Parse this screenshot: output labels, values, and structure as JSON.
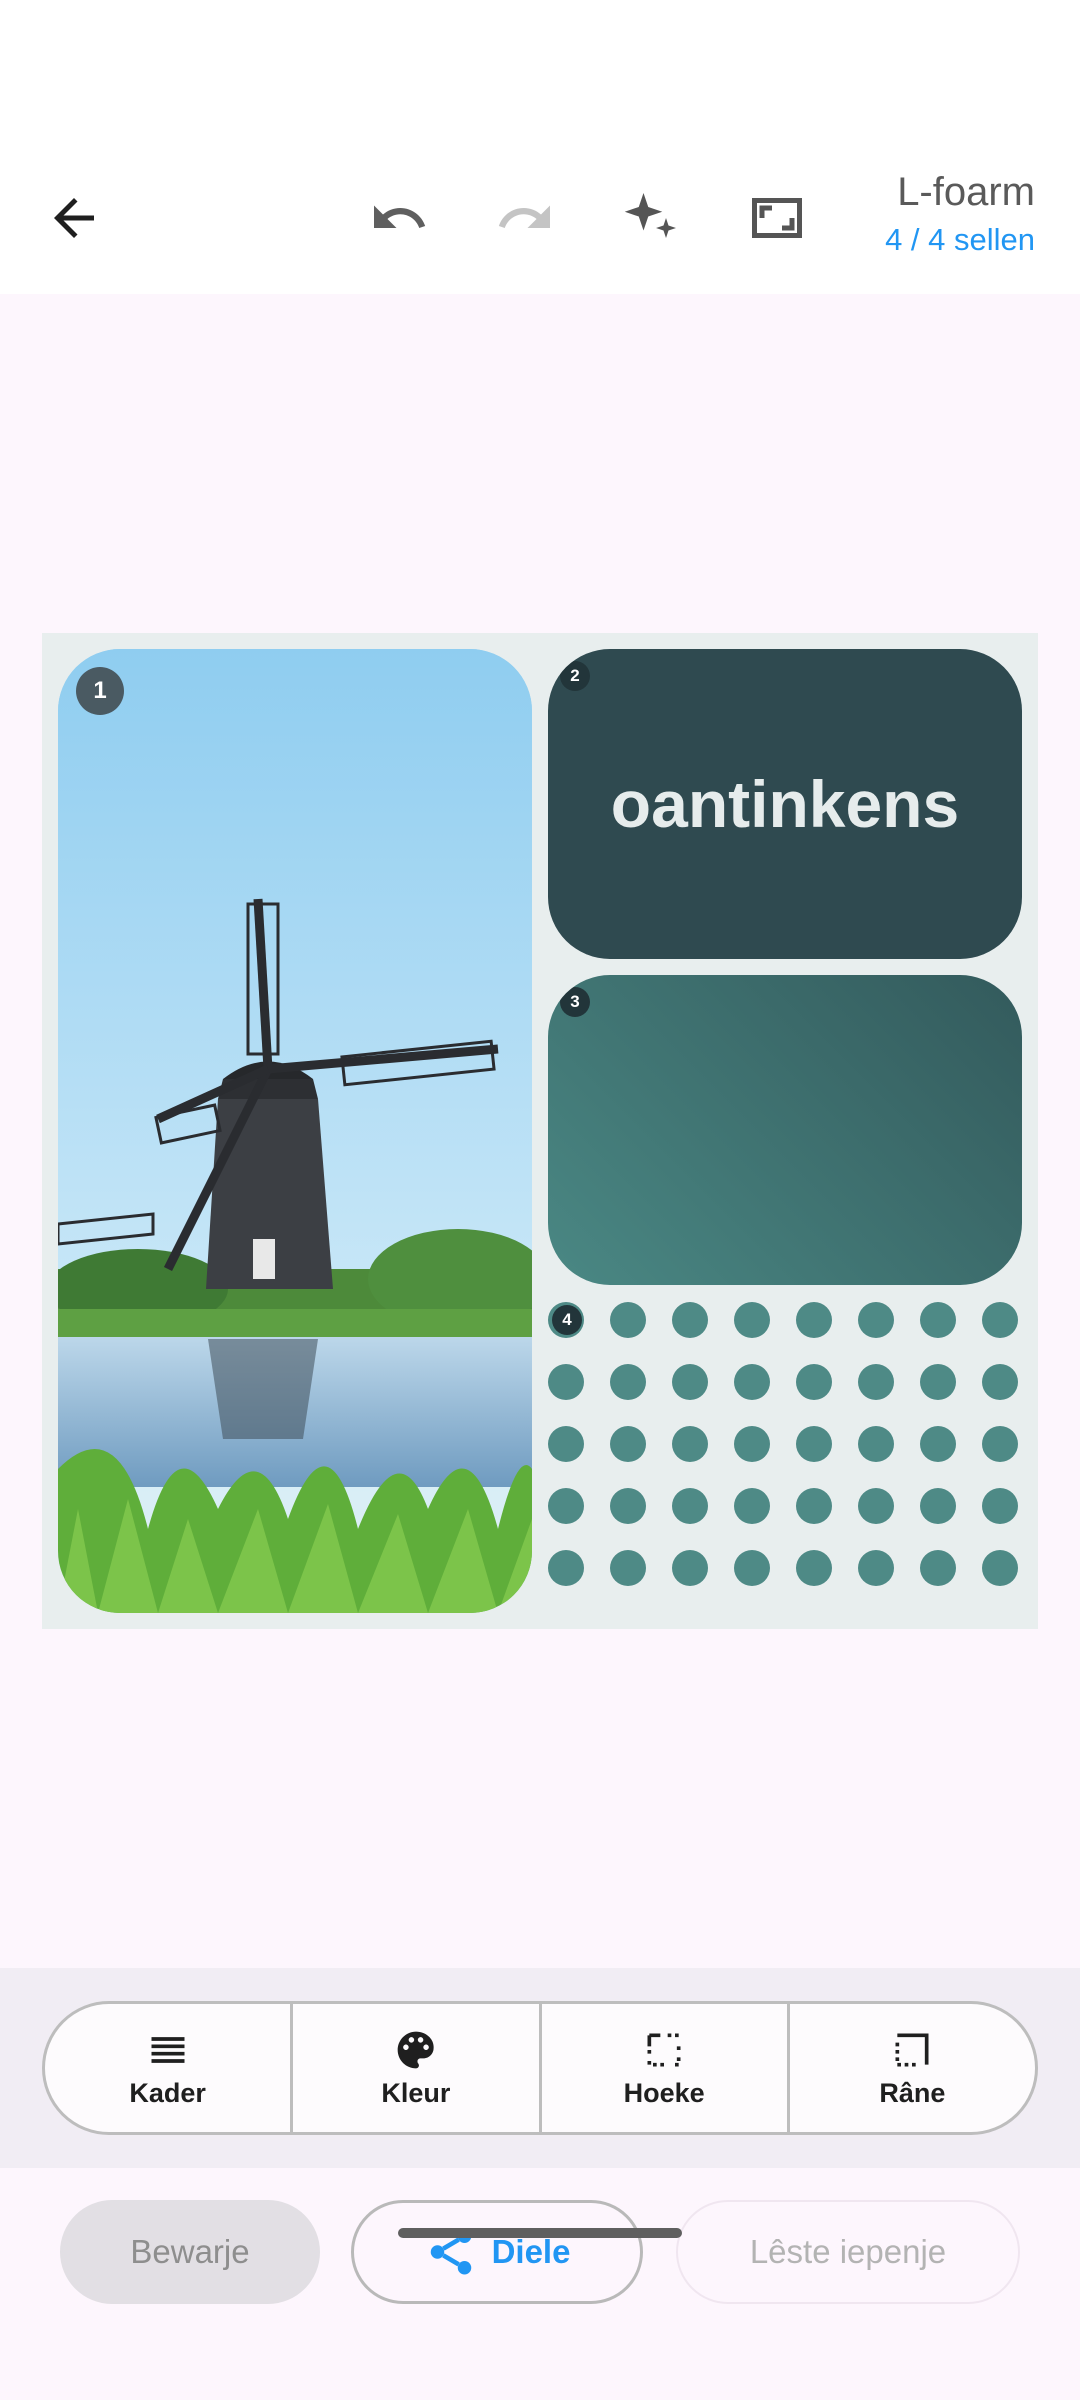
{
  "header": {
    "title": "L-foarm",
    "subtitle": "4 / 4 sellen",
    "icons": [
      "back-arrow-icon",
      "undo-icon",
      "redo-icon",
      "sparkle-icon",
      "aspect-ratio-icon"
    ]
  },
  "collage": {
    "cells": [
      {
        "number": "1",
        "content": "windmill-photo"
      },
      {
        "number": "2",
        "text": "oantinkens"
      },
      {
        "number": "3"
      },
      {
        "number": "4",
        "pattern": "dots"
      }
    ],
    "colors": {
      "background": "#e8eeee",
      "text_cell": "#2f4a50",
      "gradient_start": "#4a8884",
      "gradient_end": "#335a5c",
      "dots": "#4e8a86"
    }
  },
  "tools": {
    "items": [
      {
        "label": "Kader",
        "icon": "layers-icon"
      },
      {
        "label": "Kleur",
        "icon": "palette-icon"
      },
      {
        "label": "Hoeke",
        "icon": "corner-icon"
      },
      {
        "label": "Râne",
        "icon": "border-icon"
      }
    ]
  },
  "actions": {
    "save": "Bewarje",
    "share": "Diele",
    "last_opened": "Lêste iepenje"
  },
  "colors": {
    "accent": "#2196f3",
    "surface": "#fdf6fd"
  }
}
